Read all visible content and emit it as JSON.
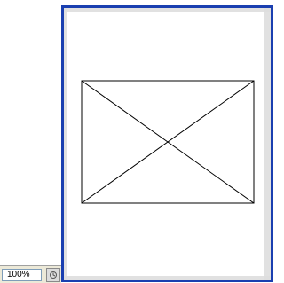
{
  "status_bar": {
    "zoom_value": "100%",
    "status_icon": "document-status-icon"
  },
  "canvas": {
    "placeholder_graphic": "placeholder-image-frame",
    "selection_color": "#1a3fb0"
  }
}
